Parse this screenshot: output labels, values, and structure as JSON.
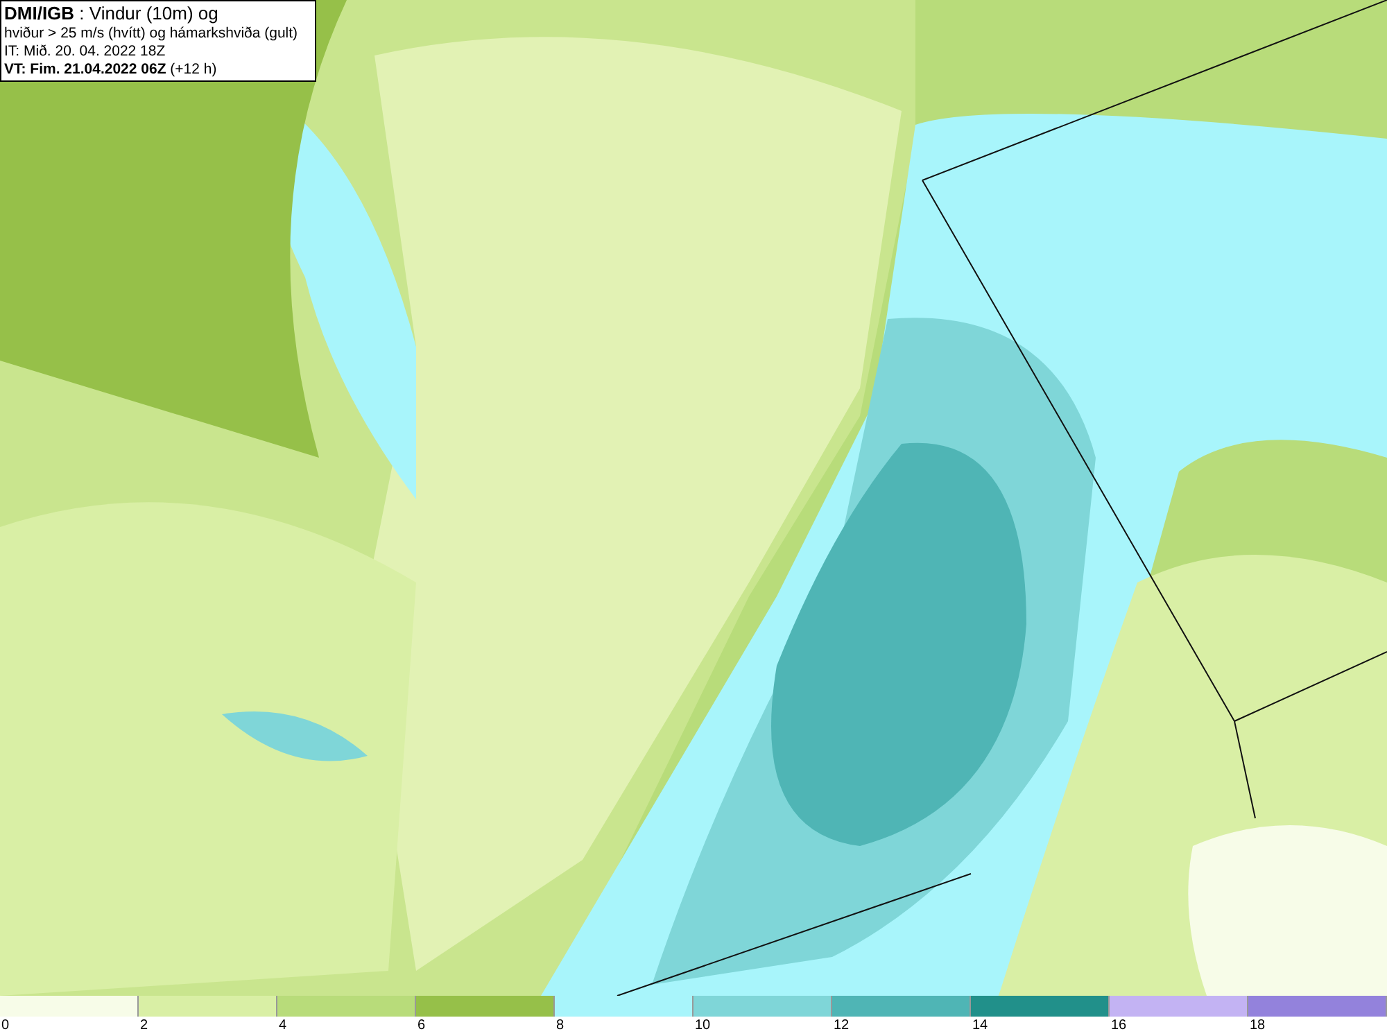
{
  "title_box": {
    "lines": [
      "**DMI/IGB** : Vindur (10m) og",
      "hviður > 25 m/s (hvítt) og hámarkshviða (gult)",
      "IT: Mið. 20. 04. 2022 18Z",
      "**VT: Fim. 21.04.2022 06Z** (+12 h)"
    ]
  },
  "legend": {
    "bins": [
      {
        "color": "#f7fce8",
        "label": "0"
      },
      {
        "color": "#d9efa5",
        "label": "2"
      },
      {
        "color": "#b8dc7a",
        "label": "4"
      },
      {
        "color": "#96c049",
        "label": "6"
      },
      {
        "color": "#a8f5fb",
        "label": "8"
      },
      {
        "color": "#7fd6d8",
        "label": "10"
      },
      {
        "color": "#4fb5b5",
        "label": "12"
      },
      {
        "color": "#21908a",
        "label": "14"
      },
      {
        "color": "#c3b3f3",
        "label": "16"
      },
      {
        "color": "#9382dc",
        "label": "18"
      }
    ]
  }
}
